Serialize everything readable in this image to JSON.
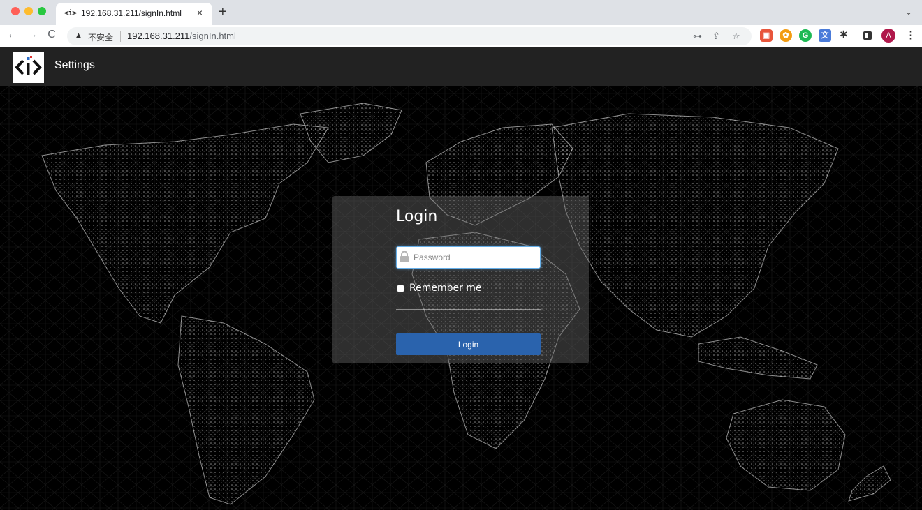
{
  "browser": {
    "tab": {
      "favicon": "<i>",
      "title": "192.168.31.211/signIn.html",
      "close": "×"
    },
    "new_tab": "+",
    "tab_menu": "⌄",
    "nav": {
      "back": "←",
      "forward": "→",
      "reload": "C"
    },
    "address_bar": {
      "security_icon": "warning-triangle-icon",
      "security_label": "不安全",
      "url_host": "192.168.31.211",
      "url_path": "/signIn.html"
    },
    "icons": {
      "key": "🔑",
      "share": "⇪",
      "star": "☆",
      "puzzle": "✱",
      "kebab": "⋮"
    },
    "profile_initial": "A"
  },
  "app": {
    "title": "Settings"
  },
  "login": {
    "title": "Login",
    "password_placeholder": "Password",
    "password_value": "",
    "remember_label": "Remember me",
    "remember_checked": false,
    "button_label": "Login"
  },
  "colors": {
    "header_bg": "#222222",
    "button_bg": "#2a63ad",
    "page_bg": "#000000"
  }
}
